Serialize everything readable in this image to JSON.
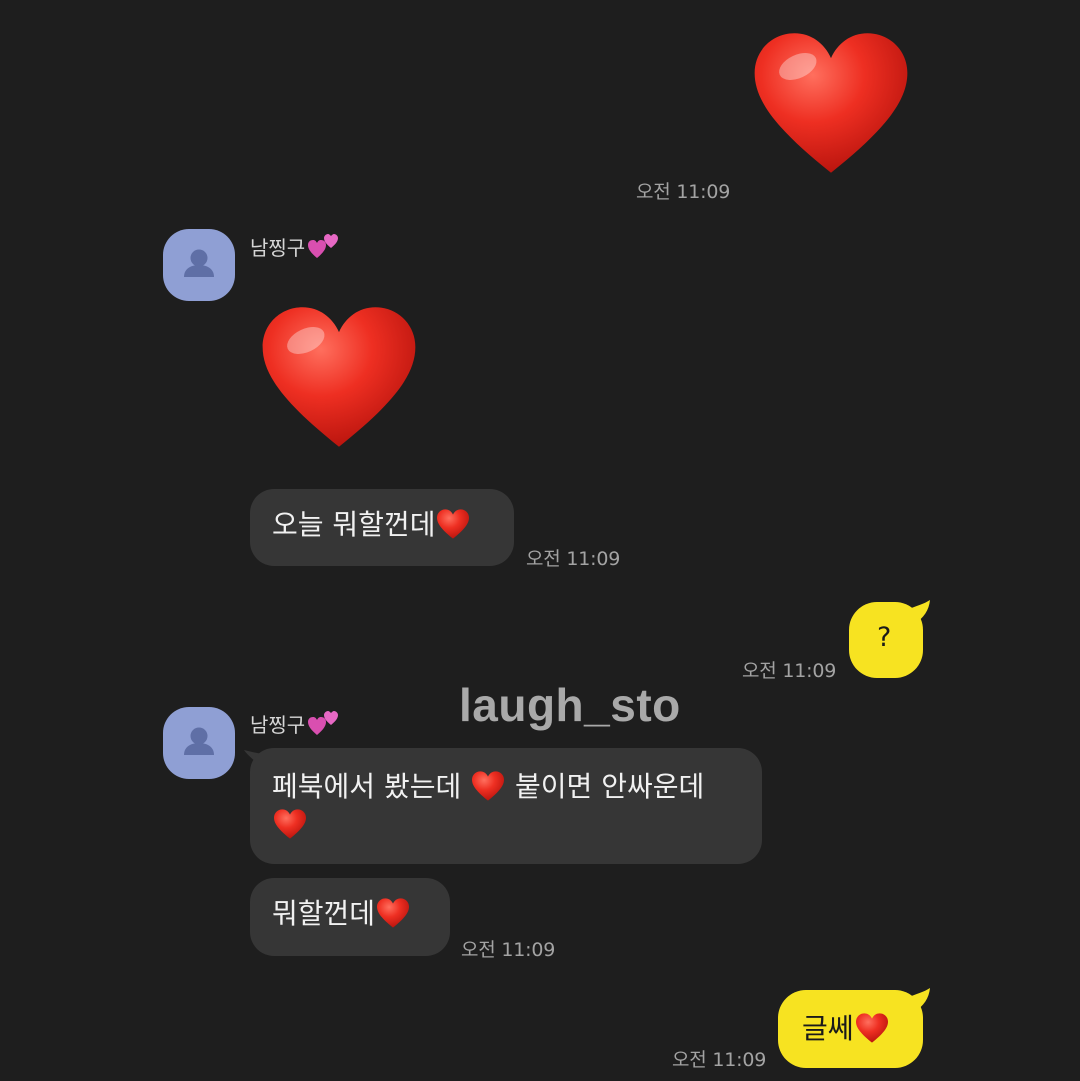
{
  "theme": {
    "background": "#1e1e1e",
    "incoming_bubble": "#363636",
    "outgoing_bubble": "#f7e321",
    "heart_color": "#e5251e",
    "avatar_color": "#8f9fd4"
  },
  "contact": {
    "name": "남찡구",
    "name_icon": "two-hearts-icon"
  },
  "messages": [
    {
      "direction": "out",
      "kind": "emoji",
      "emoji": "red-heart-icon",
      "time": "오전 11:09"
    },
    {
      "direction": "in",
      "kind": "emoji",
      "emoji": "red-heart-icon"
    },
    {
      "direction": "in",
      "kind": "text",
      "text": "오늘 뭐할껀데",
      "trailing_emoji": "red-heart-icon",
      "time": "오전 11:09"
    },
    {
      "direction": "out",
      "kind": "text",
      "text": "?",
      "time": "오전 11:09"
    },
    {
      "direction": "in",
      "kind": "text",
      "text_before": "페북에서 봤는데 ",
      "text_after": " 붙이면 안싸운데",
      "inline_emojis": [
        "red-heart-icon",
        "red-heart-icon"
      ]
    },
    {
      "direction": "in",
      "kind": "text",
      "text": "뭐할껀데",
      "trailing_emoji": "red-heart-icon",
      "time": "오전 11:09"
    },
    {
      "direction": "out",
      "kind": "text",
      "text": "글쎄",
      "trailing_emoji": "red-heart-icon",
      "time": "오전 11:09"
    }
  ],
  "watermark": "laugh_sto"
}
